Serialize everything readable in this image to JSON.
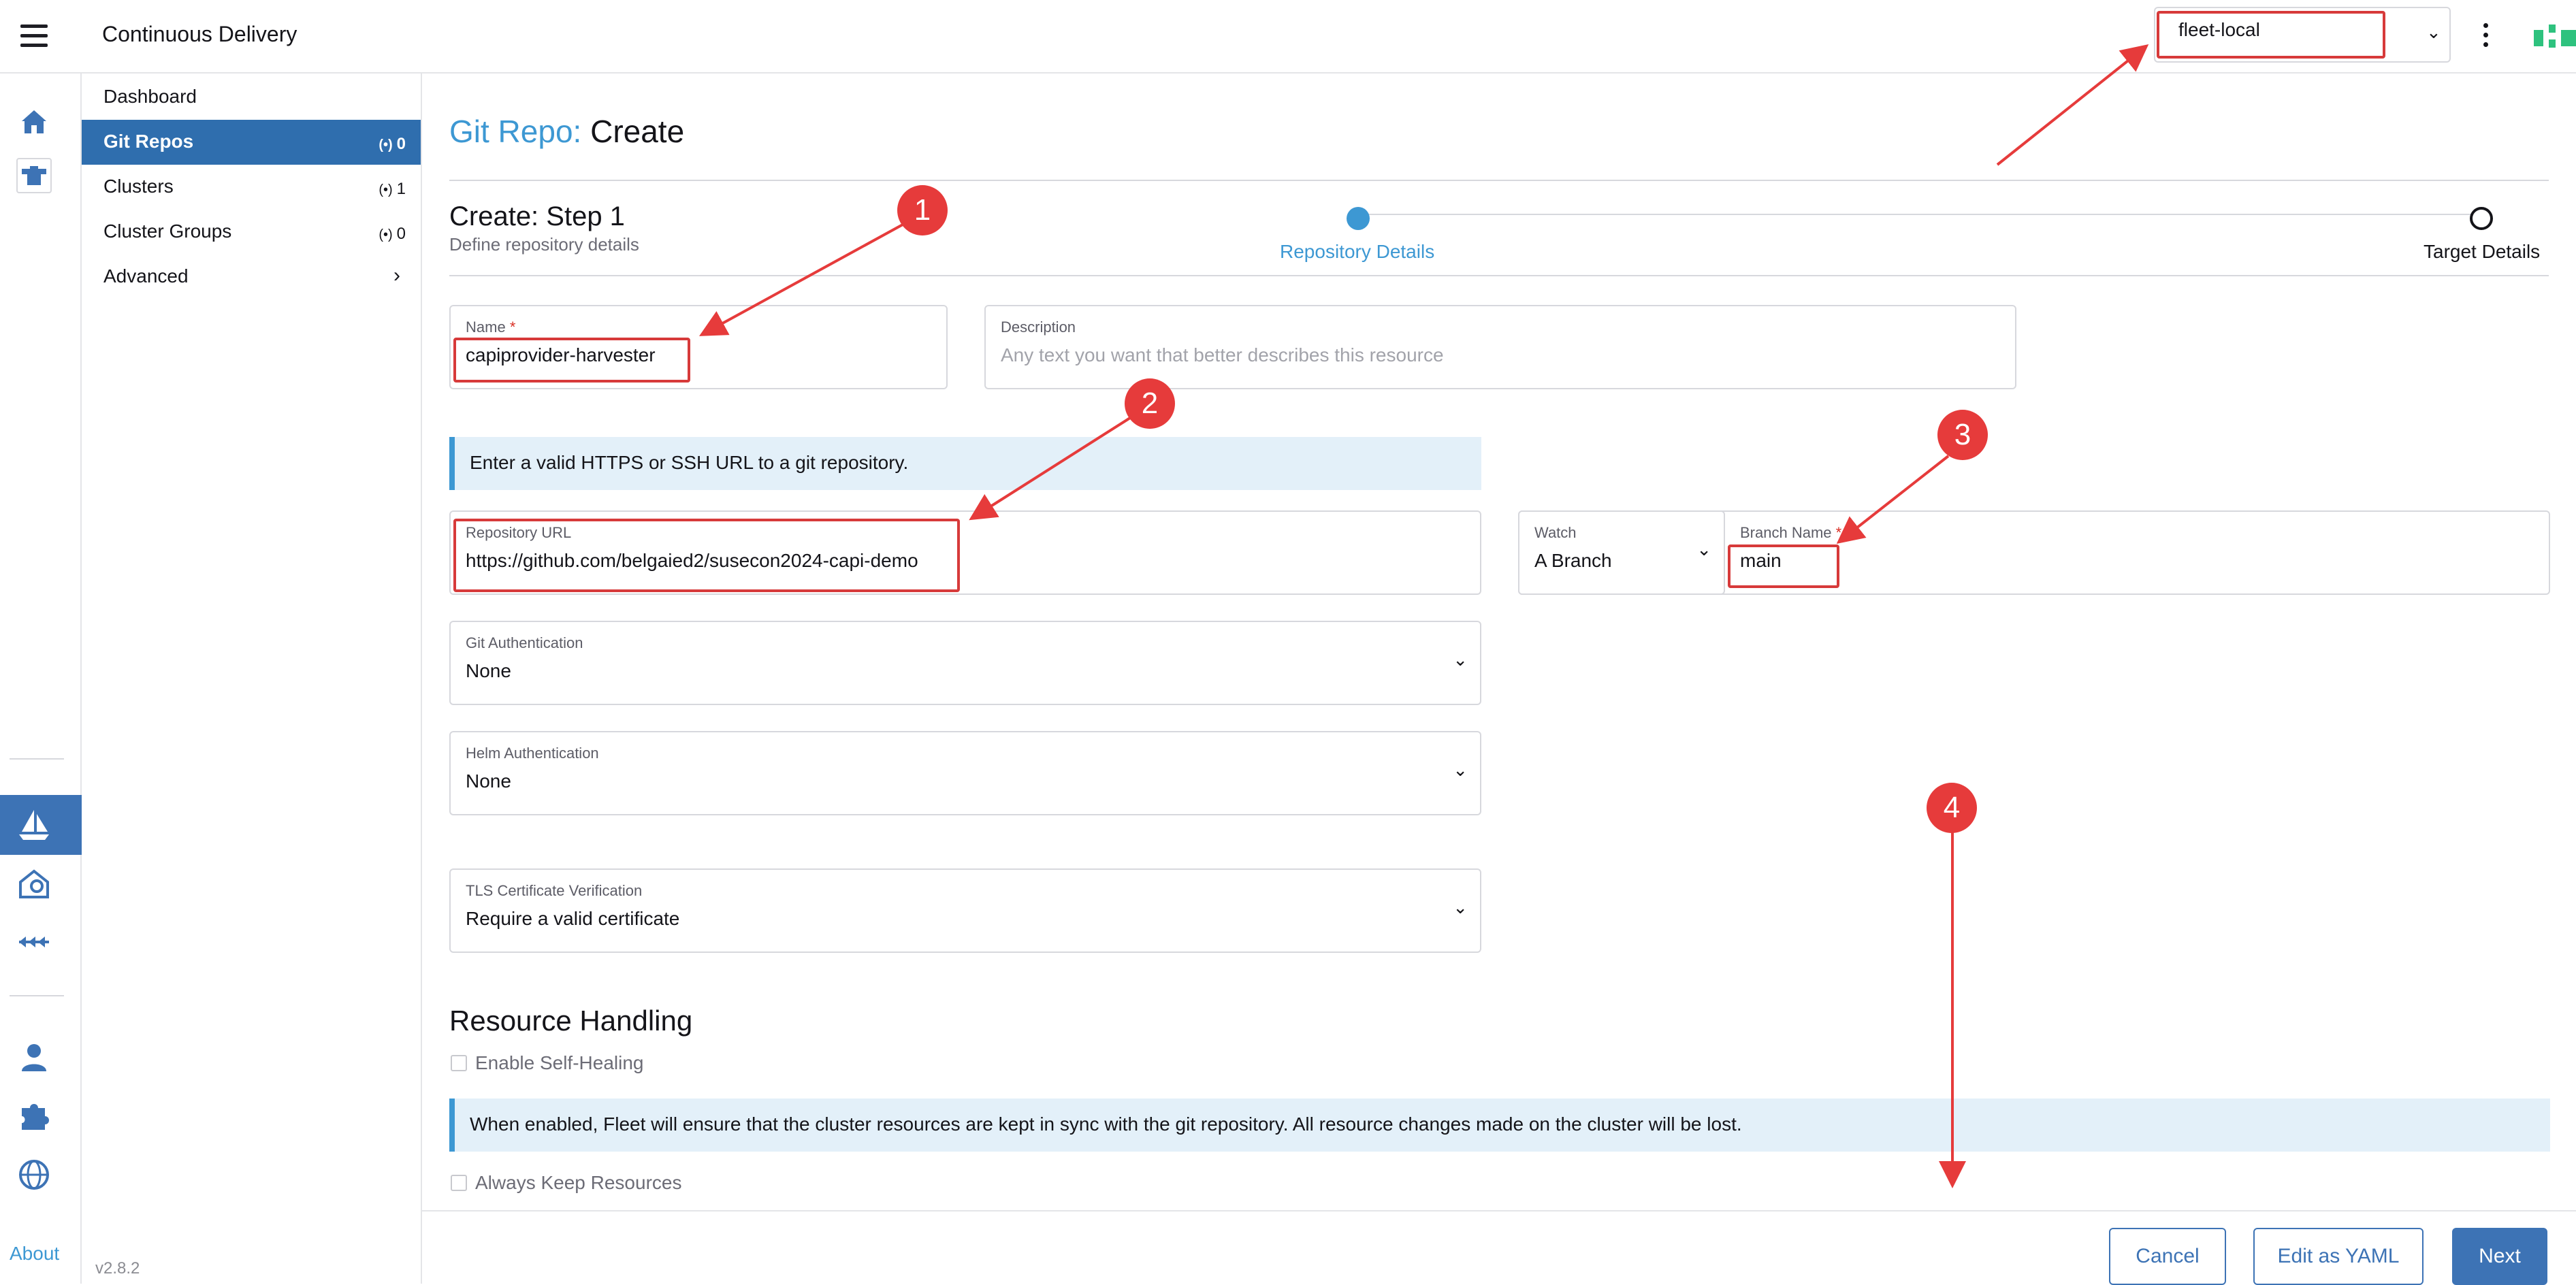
{
  "header": {
    "app_title": "Continuous Delivery",
    "cluster_selector": {
      "value": "fleet-local"
    }
  },
  "rail": {
    "icons": [
      "home-icon",
      "steer-icon",
      "sailboat-icon",
      "cloud-house-icon",
      "multi-arrows-icon",
      "user-icon",
      "puzzle-icon",
      "globe-icon"
    ],
    "about_label": "About",
    "active_icon": "sailboat-icon"
  },
  "sidenav": {
    "items": [
      {
        "label": "Dashboard",
        "count": ""
      },
      {
        "label": "Git Repos",
        "count": "0"
      },
      {
        "label": "Clusters",
        "count": "1"
      },
      {
        "label": "Cluster Groups",
        "count": "0"
      },
      {
        "label": "Advanced",
        "count": ""
      }
    ],
    "active_index": 1,
    "version": "v2.8.2"
  },
  "page": {
    "title_prefix": "Git Repo:",
    "title_main": "Create"
  },
  "wizard": {
    "step_title": "Create: Step 1",
    "step_subtitle": "Define repository details",
    "steps": [
      {
        "label": "Repository Details",
        "active": true
      },
      {
        "label": "Target Details",
        "active": false
      }
    ]
  },
  "form": {
    "name": {
      "label": "Name",
      "required_mark": "*",
      "value": "capiprovider-harvester"
    },
    "description": {
      "label": "Description",
      "placeholder": "Any text you want that better describes this resource"
    },
    "url_banner": "Enter a valid HTTPS or SSH URL to a git repository.",
    "repo_url": {
      "label": "Repository URL",
      "value": "https://github.com/belgaied2/susecon2024-capi-demo"
    },
    "watch": {
      "label": "Watch",
      "value": "A Branch"
    },
    "branch": {
      "label": "Branch Name",
      "required_mark": "*",
      "value": "main"
    },
    "git_auth": {
      "label": "Git Authentication",
      "value": "None"
    },
    "helm_auth": {
      "label": "Helm Authentication",
      "value": "None"
    },
    "tls": {
      "label": "TLS Certificate Verification",
      "value": "Require a valid certificate"
    }
  },
  "resource_handling": {
    "title": "Resource Handling",
    "self_healing_label": "Enable Self-Healing",
    "self_healing_checked": false,
    "info_banner": "When enabled, Fleet will ensure that the cluster resources are kept in sync with the git repository. All resource changes made on the cluster will be lost.",
    "keep_resources_label": "Always Keep Resources",
    "keep_resources_checked": false
  },
  "footer": {
    "cancel_label": "Cancel",
    "yaml_label": "Edit as YAML",
    "next_label": "Next"
  },
  "annotations": {
    "badges": [
      "1",
      "2",
      "3",
      "4"
    ],
    "color": "#e63b3b"
  },
  "colors": {
    "accent": "#3d98d3",
    "primary": "#3d73b5",
    "nav_active": "#2f6eae"
  }
}
